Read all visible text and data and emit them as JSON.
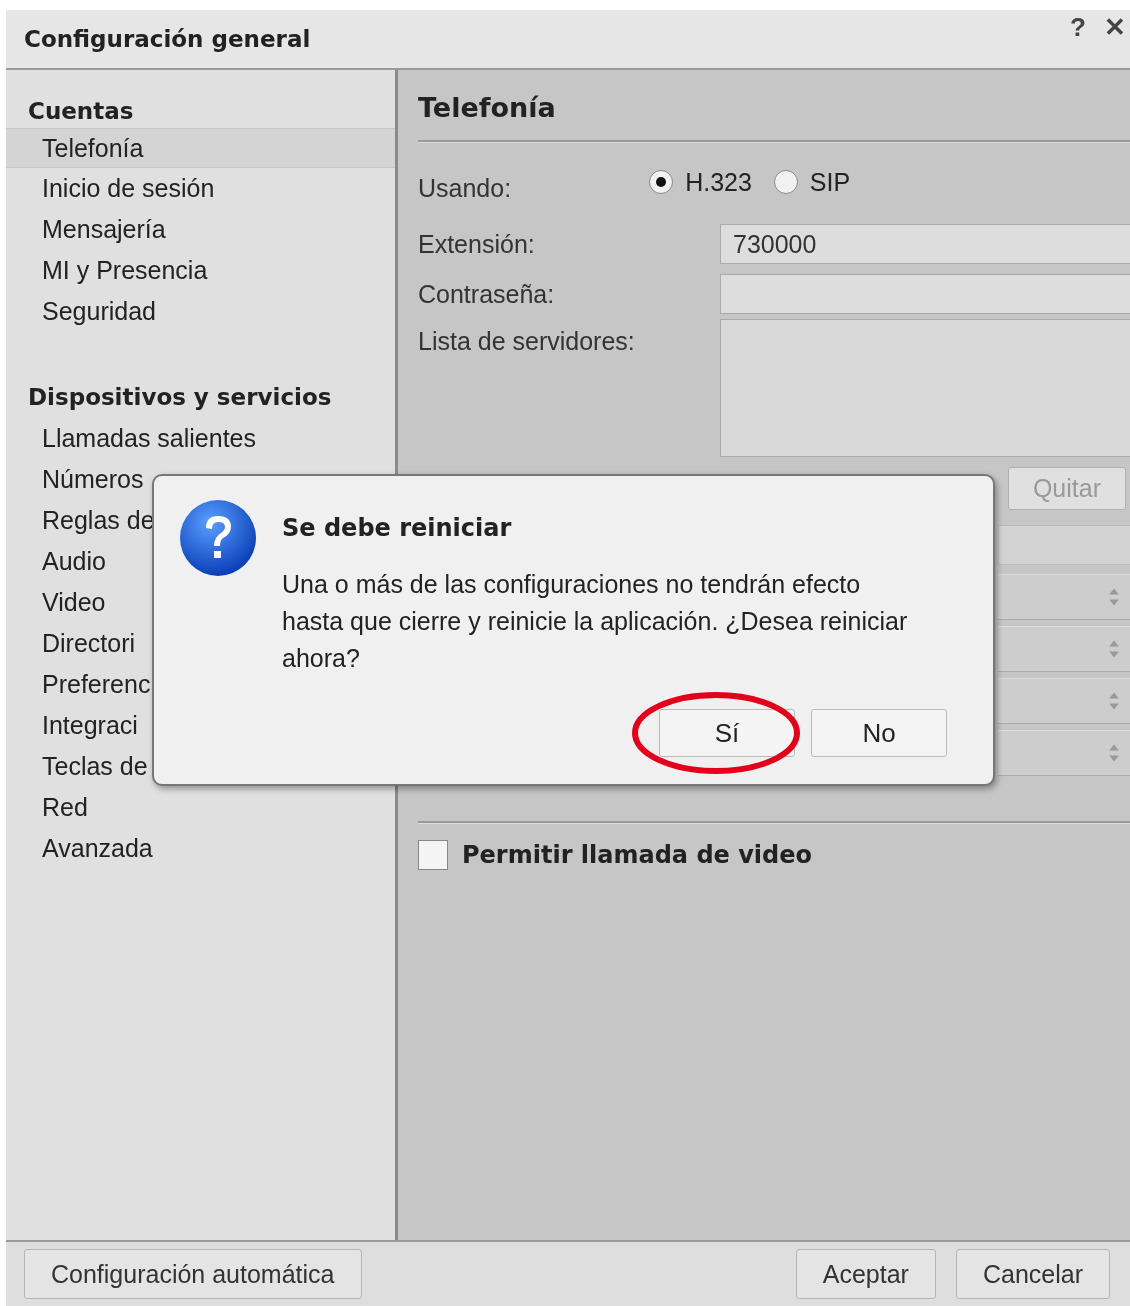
{
  "window": {
    "title": "Configuración general",
    "help": "?",
    "close": "✕"
  },
  "sidebar": {
    "sections": [
      {
        "title": "Cuentas",
        "items": [
          {
            "label": "Telefonía",
            "selected": true
          },
          {
            "label": "Inicio de sesión",
            "selected": false
          },
          {
            "label": "Mensajería",
            "selected": false
          },
          {
            "label": "MI y Presencia",
            "selected": false
          },
          {
            "label": "Seguridad",
            "selected": false
          }
        ]
      },
      {
        "title": "Dispositivos y servicios",
        "items": [
          {
            "label": "Llamadas salientes",
            "selected": false
          },
          {
            "label": "Números",
            "selected": false
          },
          {
            "label": "Reglas de",
            "selected": false
          },
          {
            "label": "Audio",
            "selected": false
          },
          {
            "label": "Video",
            "selected": false
          },
          {
            "label": "Directori",
            "selected": false
          },
          {
            "label": "Preferenc",
            "selected": false
          },
          {
            "label": "Integraci",
            "selected": false
          },
          {
            "label": "Teclas de",
            "selected": false
          },
          {
            "label": "Red",
            "selected": false
          },
          {
            "label": "Avanzada",
            "selected": false
          }
        ]
      }
    ]
  },
  "content": {
    "title": "Telefonía",
    "using": {
      "label": "Usando:",
      "options": [
        {
          "label": "H.323",
          "selected": true
        },
        {
          "label": "SIP",
          "selected": false
        }
      ]
    },
    "fields": [
      {
        "label": "Extensión:",
        "value": "730000"
      },
      {
        "label": "Contraseña:"
      }
    ],
    "server_list": {
      "label": "Lista de servidores:"
    },
    "remove_button": {
      "label": "Quitar",
      "disabled": true
    },
    "hidden_rows": [
      {
        "kind": "field"
      },
      {
        "kind": "select"
      },
      {
        "kind": "select"
      },
      {
        "kind": "select"
      },
      {
        "kind": "select"
      }
    ],
    "video_checkbox": {
      "label": "Permitir llamada de video",
      "checked": false
    }
  },
  "dialog": {
    "title": "Se debe reiniciar",
    "message": "Una o más de las configuraciones no tendrán efecto hasta que cierre y reinicie la aplicación. ¿Desea reiniciar ahora?",
    "buttons": [
      {
        "label": "Sí",
        "circled": true
      },
      {
        "label": "No",
        "circled": false
      }
    ]
  },
  "footer": {
    "auto_button": "Configuración automática",
    "buttons": [
      "Aceptar",
      "Cancelar"
    ]
  }
}
